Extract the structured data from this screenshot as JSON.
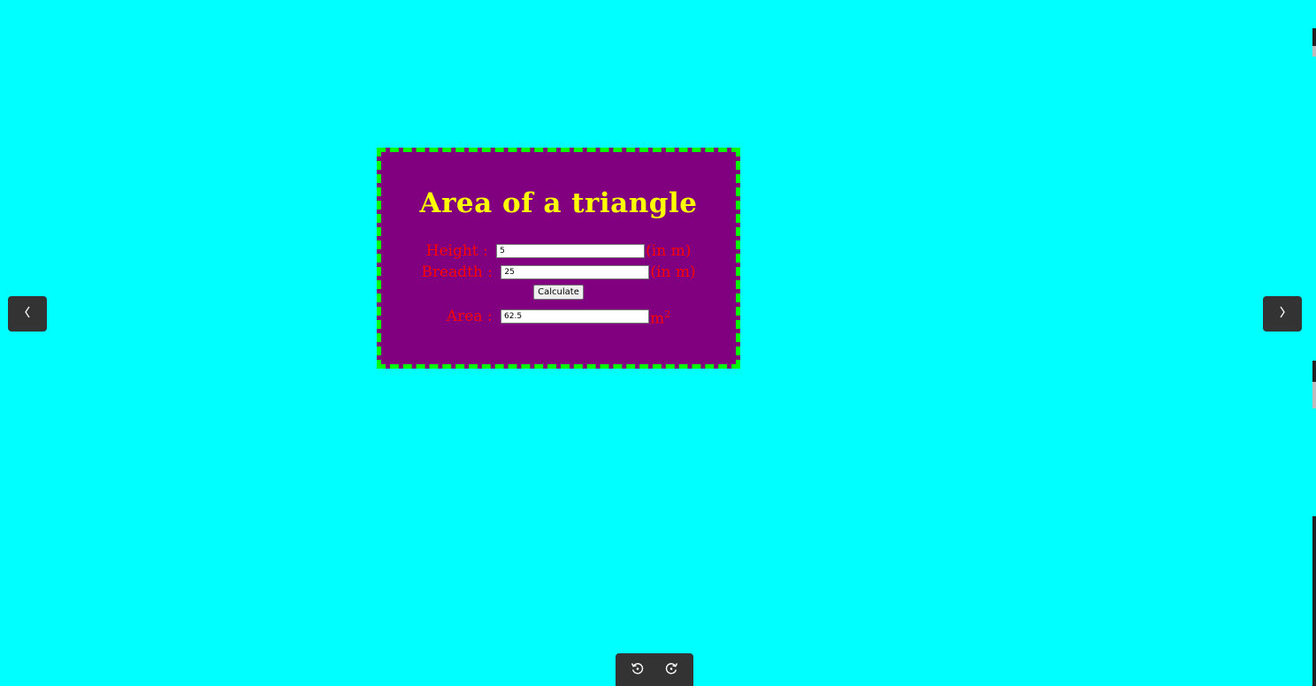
{
  "card": {
    "title": "Area of a triangle",
    "height_label": "Height : ",
    "height_value": "5",
    "height_unit": "(in m)",
    "breadth_label": "Breadth : ",
    "breadth_value": "25",
    "breadth_unit": "(in m)",
    "calculate_label": "Calculate",
    "area_label": "Area : ",
    "area_value": "62.5",
    "area_unit": "m",
    "area_unit_exponent": "2"
  },
  "viewer": {
    "prev_icon": "chevron-left-icon",
    "next_icon": "chevron-right-icon",
    "rotate_left_icon": "rotate-left-icon",
    "rotate_right_icon": "rotate-right-icon"
  },
  "colors": {
    "page_background": "#00ffff",
    "card_background": "#800080",
    "card_border": "#00ff00",
    "title": "#ffff00",
    "label": "#ff0000",
    "viewer_controls": "#333333"
  }
}
